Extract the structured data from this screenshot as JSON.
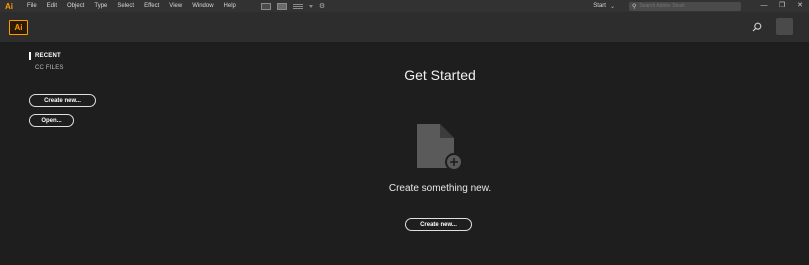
{
  "menubar": {
    "app_logo": "Ai",
    "items": [
      "File",
      "Edit",
      "Object",
      "Type",
      "Select",
      "Effect",
      "View",
      "Window",
      "Help"
    ],
    "workspace": "Start",
    "search_placeholder": "Search Adobe Stock",
    "window_controls": {
      "minimize": "—",
      "restore": "❐",
      "close": "✕"
    }
  },
  "header": {
    "app_logo": "Ai",
    "accent_color": "#ff9a00"
  },
  "sidebar": {
    "recent_label": "RECENT",
    "cc_files_label": "CC FILES",
    "create_new_label": "Create new...",
    "open_label": "Open..."
  },
  "main": {
    "title": "Get Started",
    "empty_icon": "new-document-icon",
    "message": "Create something new.",
    "create_new_label": "Create new..."
  }
}
